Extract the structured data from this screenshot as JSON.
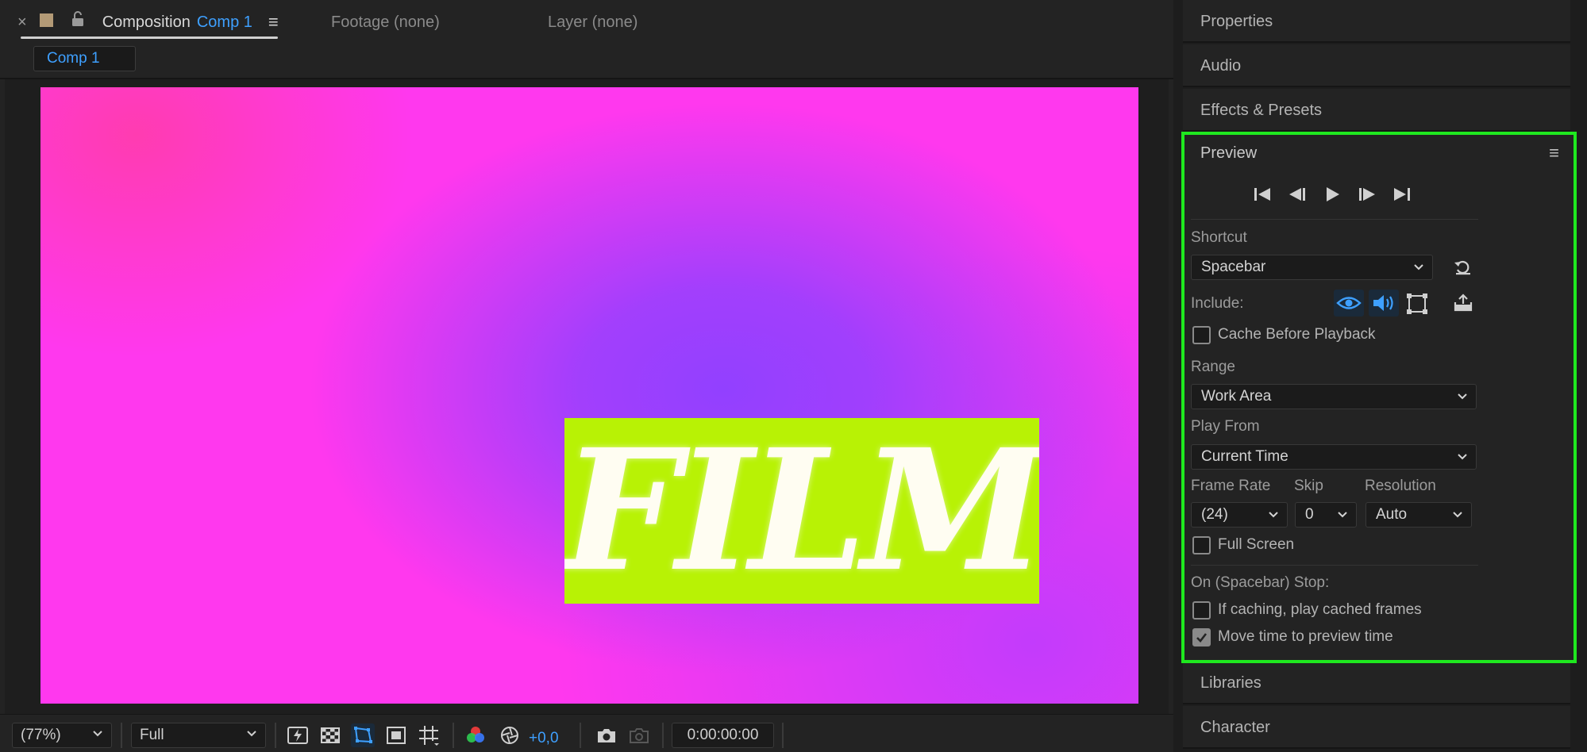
{
  "composition_panel": {
    "tab": {
      "close_glyph": "×",
      "label": "Composition",
      "comp_name": "Comp 1",
      "menu_glyph": "≡"
    },
    "footage_tab": "Footage (none)",
    "layer_tab": "Layer (none)",
    "comp_chip": "Comp 1",
    "canvas_text": "FILM",
    "bottom_bar": {
      "zoom": "(77%)",
      "resolution": "Full",
      "exposure": "+0,0",
      "timecode": "0:00:00:00"
    }
  },
  "right_panels": {
    "properties": "Properties",
    "audio": "Audio",
    "effects_presets": "Effects & Presets",
    "libraries": "Libraries",
    "character": "Character"
  },
  "preview": {
    "title": "Preview",
    "menu_glyph": "≡",
    "shortcut_label": "Shortcut",
    "shortcut_value": "Spacebar",
    "include_label": "Include:",
    "cache_before_playback": "Cache Before Playback",
    "range_label": "Range",
    "range_value": "Work Area",
    "play_from_label": "Play From",
    "play_from_value": "Current Time",
    "frame_rate_label": "Frame Rate",
    "frame_rate_value": "(24)",
    "skip_label": "Skip",
    "skip_value": "0",
    "resolution_label": "Resolution",
    "resolution_value": "Auto",
    "full_screen": "Full Screen",
    "on_stop_label": "On (Spacebar) Stop:",
    "if_caching": "If caching, play cached frames",
    "move_time": "Move time to preview time",
    "checkbox_states": {
      "cache_before_playback": false,
      "full_screen": false,
      "if_caching": false,
      "move_time": true
    }
  },
  "colors": {
    "accent_blue": "#3ea0ff",
    "highlight_green": "#1fe81f",
    "canvas_pink": "#ff38ee",
    "canvas_purple": "#9240ff",
    "film_box_lime": "#b8f205"
  }
}
